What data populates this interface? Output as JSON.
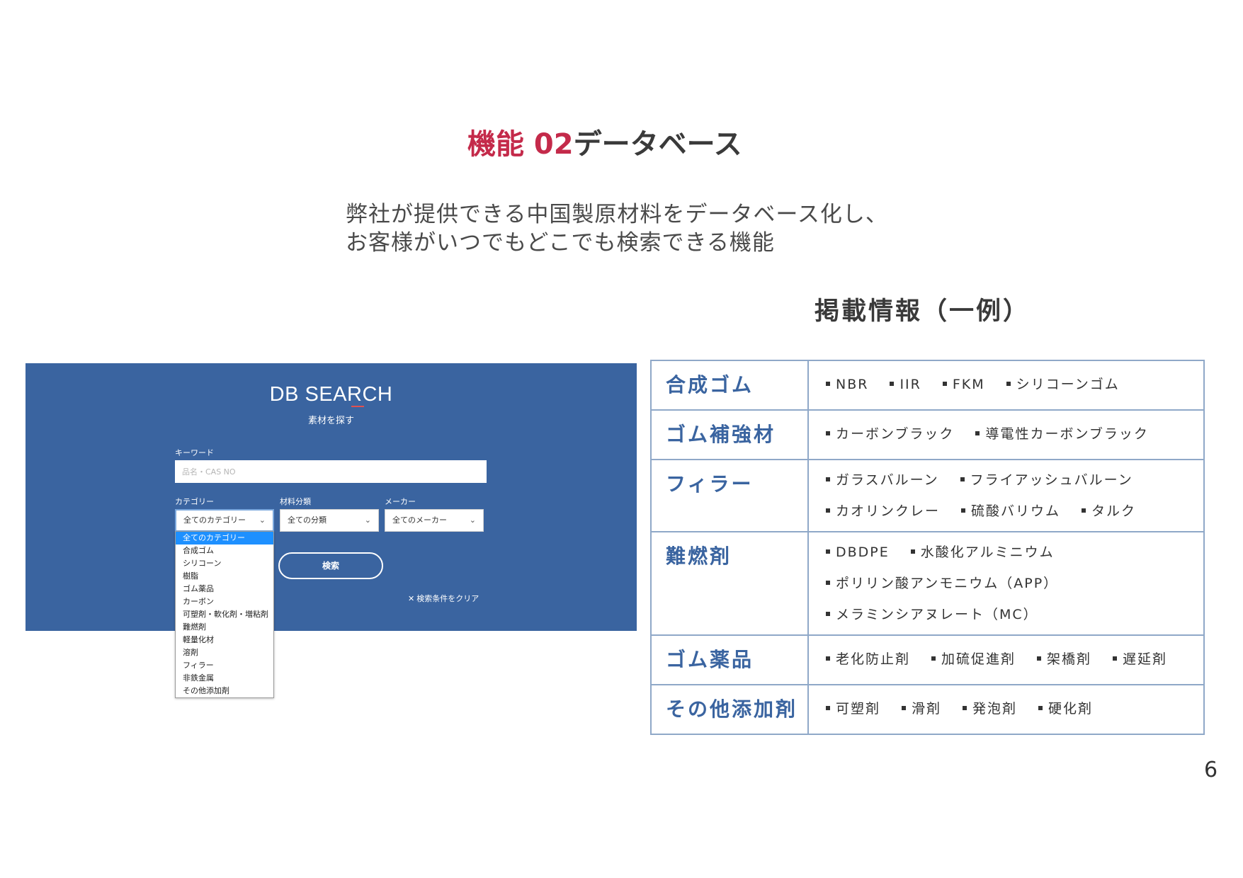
{
  "slide": {
    "title_accent": "機能 02",
    "title_rest": "データベース",
    "intro_lines": [
      "弊社が提供できる中国製原材料をデータベース化し、",
      "お客様がいつでもどこでも検索できる機能"
    ],
    "examples_heading": "掲載情報（一例）",
    "page_number": "6"
  },
  "db_search": {
    "title": "DB SEARCH",
    "subtitle": "素材を探す",
    "keyword_label": "キーワード",
    "keyword_placeholder": "品名・CAS NO",
    "category_label": "カテゴリー",
    "category_value": "全てのカテゴリー",
    "material_label": "材料分類",
    "material_value": "全ての分類",
    "maker_label": "メーカー",
    "maker_value": "全てのメーカー",
    "search_button": "検索",
    "clear_link": "検索条件をクリア",
    "dropdown_options": [
      "全てのカテゴリー",
      "合成ゴム",
      "シリコーン",
      "樹脂",
      "ゴム薬品",
      "カーボン",
      "可塑剤・軟化剤・増粘剤",
      "難燃剤",
      "軽量化材",
      "溶剤",
      "フィラー",
      "非鉄金属",
      "その他添加剤"
    ],
    "selected_option_index": 0
  },
  "table": {
    "rows": [
      {
        "category": "合成ゴム",
        "lines": [
          [
            "NBR",
            "IIR",
            "FKM",
            "シリコーンゴム"
          ]
        ]
      },
      {
        "category": "ゴム補強材",
        "lines": [
          [
            "カーボンブラック",
            "導電性カーボンブラック"
          ]
        ]
      },
      {
        "category": "フィラー",
        "lines": [
          [
            "ガラスバルーン",
            "フライアッシュバルーン"
          ],
          [
            "カオリンクレー",
            "硫酸バリウム",
            "タルク"
          ]
        ]
      },
      {
        "category": "難燃剤",
        "lines": [
          [
            "DBDPE",
            "水酸化アルミニウム"
          ],
          [
            "ポリリン酸アンモニウム（APP）"
          ],
          [
            "メラミンシアヌレート（MC）"
          ]
        ]
      },
      {
        "category": "ゴム薬品",
        "lines": [
          [
            "老化防止剤",
            "加硫促進剤",
            "架橋剤",
            "遅延剤"
          ]
        ]
      },
      {
        "category": "その他添加剤",
        "lines": [
          [
            "可塑剤",
            "滑剤",
            "発泡剤",
            "硬化剤"
          ]
        ]
      }
    ]
  },
  "colors": {
    "accent": "#c42a4a",
    "panel_blue": "#3a64a0",
    "table_border": "#8fa8c8",
    "category_text": "#3a64a0",
    "dropdown_selected": "#1e90ff"
  }
}
